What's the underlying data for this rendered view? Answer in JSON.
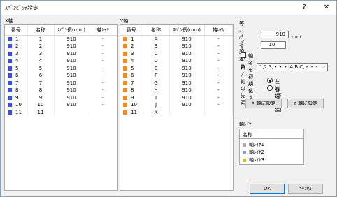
{
  "window": {
    "title": "ｽﾊﾟﾝﾋﾟｯﾁ設定",
    "help": "?",
    "close": "✕"
  },
  "x_axis": {
    "label": "X軸",
    "headers": [
      "番号",
      "名称",
      "ｽﾊﾟﾝ長(mm)",
      "軸ﾚｲﾔ"
    ],
    "rows": [
      [
        "1",
        "1",
        "910",
        "-"
      ],
      [
        "2",
        "2",
        "910",
        "-"
      ],
      [
        "3",
        "3",
        "910",
        "-"
      ],
      [
        "4",
        "4",
        "910",
        "-"
      ],
      [
        "5",
        "5",
        "910",
        "-"
      ],
      [
        "6",
        "6",
        "910",
        "-"
      ],
      [
        "7",
        "7",
        "910",
        "-"
      ],
      [
        "8",
        "8",
        "910",
        "-"
      ],
      [
        "9",
        "9",
        "910",
        "-"
      ],
      [
        "10",
        "10",
        "910",
        "-"
      ],
      [
        "11",
        "11",
        "",
        ""
      ]
    ]
  },
  "y_axis": {
    "label": "Y軸",
    "headers": [
      "番号",
      "名称",
      "ｽﾊﾟﾝ長(mm)",
      "軸ﾚｲﾔ"
    ],
    "rows": [
      [
        "1",
        "A",
        "910",
        "-"
      ],
      [
        "2",
        "B",
        "910",
        "-"
      ],
      [
        "3",
        "C",
        "910",
        "-"
      ],
      [
        "4",
        "D",
        "910",
        "-"
      ],
      [
        "5",
        "E",
        "910",
        "-"
      ],
      [
        "6",
        "F",
        "910",
        "-"
      ],
      [
        "7",
        "G",
        "910",
        "-"
      ],
      [
        "8",
        "H",
        "910",
        "-"
      ],
      [
        "9",
        "I",
        "910",
        "-"
      ],
      [
        "10",
        "J",
        "910",
        "-"
      ],
      [
        "11",
        "K",
        "",
        ""
      ]
    ]
  },
  "equal_span": {
    "title": "等ｽﾊﾟﾝ設定",
    "span_length_label": "ｽﾊﾟﾝ長",
    "span_length_value": "910",
    "span_length_unit": "mm",
    "span_count_label": "ｽﾊﾟﾝ数",
    "span_count_value": "10",
    "init_names_label": "軸名を初期化する",
    "type_label": "ﾀｲﾌﾟ",
    "type_value": "1,2,3,・・・|A,B,C,・・・",
    "axis_start_label": "軸の先頭",
    "radio_left_label": "左端(下端)",
    "radio_right_label": "右端(上端)",
    "x_set_button": "X 軸に設定",
    "y_set_button": "Y 軸に設定"
  },
  "axis_layer": {
    "title": "軸ﾚｲﾔ",
    "header": "名称",
    "items": [
      {
        "label": "軸ﾚｲﾔ1",
        "color": "#b0b0b0"
      },
      {
        "label": "軸ﾚｲﾔ2",
        "color": "#7fa3d6"
      },
      {
        "label": "軸ﾚｲﾔ3",
        "color": "#d4c21e"
      }
    ]
  },
  "footer": {
    "ok": "OK",
    "cancel": "ｷｬﾝｾﾙ"
  },
  "colors": {
    "x_marker": "#3b4fd6",
    "y_marker": "#f08a24"
  }
}
